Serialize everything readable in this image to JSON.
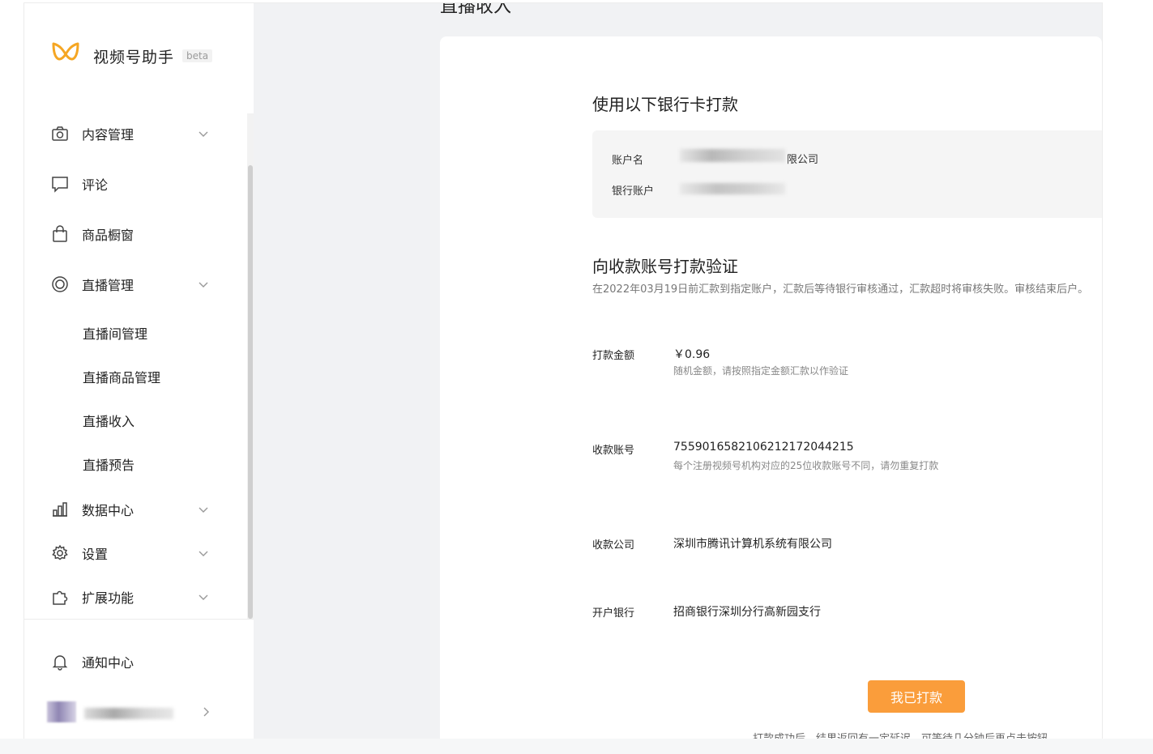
{
  "brand": {
    "name": "视频号助手",
    "badge": "beta"
  },
  "sidebar": {
    "items": [
      {
        "label": "内容管理",
        "icon": "camera-icon",
        "expandable": true
      },
      {
        "label": "评论",
        "icon": "comment-icon",
        "expandable": false
      },
      {
        "label": "商品橱窗",
        "icon": "shopping-bag-icon",
        "expandable": false
      },
      {
        "label": "直播管理",
        "icon": "live-icon",
        "expandable": true
      },
      {
        "label": "数据中心",
        "icon": "bar-chart-icon",
        "expandable": true
      },
      {
        "label": "设置",
        "icon": "gear-icon",
        "expandable": true
      },
      {
        "label": "扩展功能",
        "icon": "puzzle-icon",
        "expandable": true
      }
    ],
    "live_sub_items": [
      "直播间管理",
      "直播商品管理",
      "直播收入",
      "直播预告"
    ],
    "notification": "通知中心"
  },
  "main": {
    "page_title": "直播收入",
    "bank_section_title": "使用以下银行卡打款",
    "account_name_label": "账户名",
    "account_name_suffix": "限公司",
    "bank_account_label": "银行账户",
    "verify_title": "向收款账号打款验证",
    "verify_desc": "在2022年03月19日前汇款到指定账户，汇款后等待银行审核通过，汇款超时将审核失败。审核结束后户。",
    "fields": [
      {
        "label": "打款金额",
        "value": "￥0.96",
        "hint": "随机金额，请按照指定金额汇款以作验证"
      },
      {
        "label": "收款账号",
        "value": "7559016582106212172044215",
        "hint": "每个注册视频号机构对应的25位收款账号不同，请勿重复打款"
      },
      {
        "label": "收款公司",
        "value": "深圳市腾讯计算机系统有限公司",
        "hint": ""
      },
      {
        "label": "开户银行",
        "value": "招商银行深圳分行高新园支行",
        "hint": ""
      }
    ],
    "confirm_button": "我已打款",
    "bottom_note": "打款成功后，结果返回有一定延迟，可等待几分钟后再点击按钮。"
  },
  "colors": {
    "accent": "#fa9d3b",
    "logo": "#f5a623",
    "sidebar_bg": "#ffffff",
    "content_bg": "#f1f2f4",
    "bank_box_bg": "#f5f5f5"
  }
}
